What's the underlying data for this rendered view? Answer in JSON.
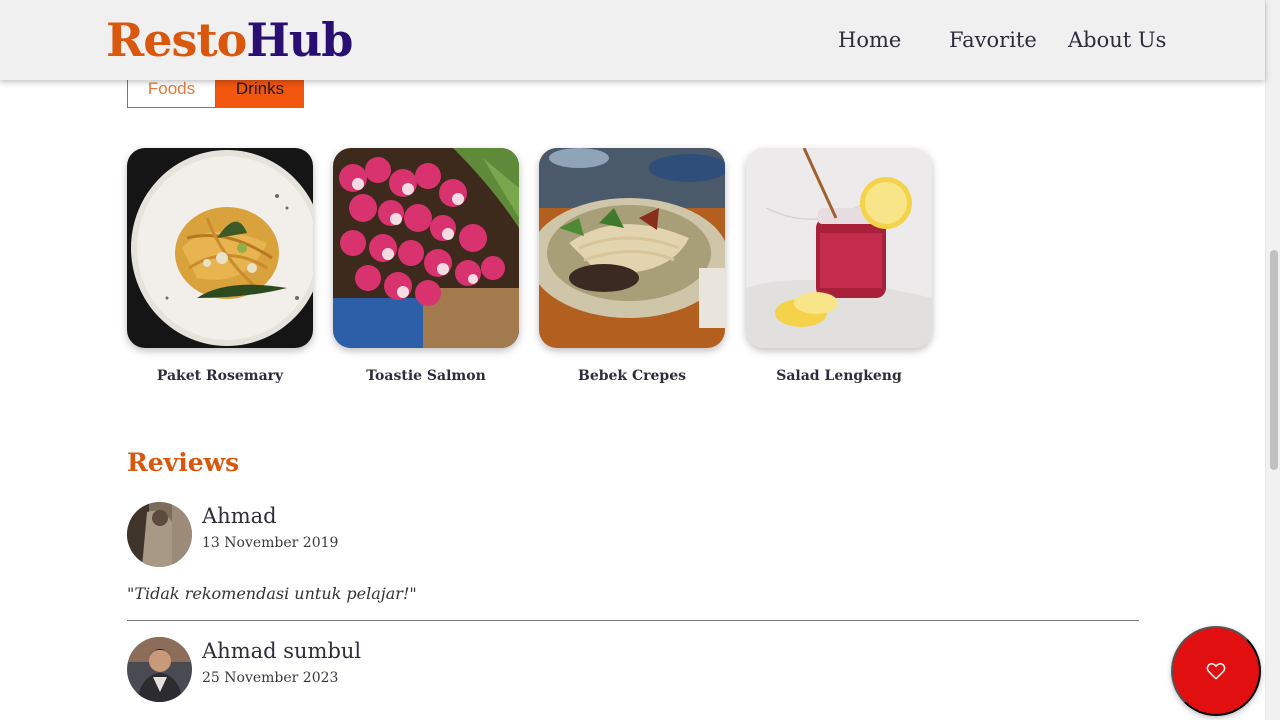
{
  "brand": {
    "part1": "Resto",
    "part2": "Hub"
  },
  "nav": {
    "home": "Home",
    "favorite": "Favorite",
    "about": "About Us"
  },
  "tabs": {
    "foods": "Foods",
    "drinks": "Drinks",
    "active": "Drinks"
  },
  "menu": [
    {
      "name": "Paket Rosemary"
    },
    {
      "name": "Toastie Salmon"
    },
    {
      "name": "Bebek Crepes"
    },
    {
      "name": "Salad Lengkeng"
    }
  ],
  "reviews_title": "Reviews",
  "reviews": [
    {
      "name": "Ahmad",
      "date": "13 November 2019",
      "text": "\"Tidak rekomendasi untuk pelajar!\""
    },
    {
      "name": "Ahmad sumbul",
      "date": "25 November 2023"
    }
  ],
  "icons": {
    "fab": "heart-icon"
  },
  "colors": {
    "brand_orange": "#d9580d",
    "brand_purple": "#2a0f73",
    "tab_active": "#f2560f",
    "fab": "#e10f0f"
  }
}
